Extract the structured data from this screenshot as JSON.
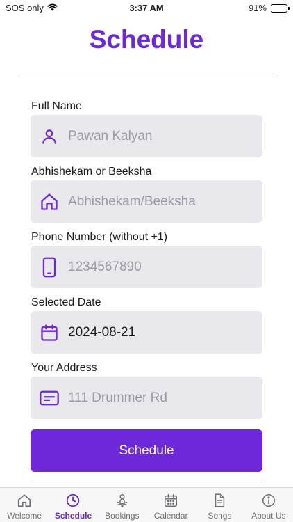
{
  "status_bar": {
    "carrier": "SOS only",
    "time": "3:37 AM",
    "battery": "91%",
    "battery_level": 0.91
  },
  "page": {
    "title": "Schedule"
  },
  "form": {
    "full_name": {
      "label": "Full Name",
      "placeholder": "Pawan Kalyan",
      "value": "",
      "icon": "person-icon"
    },
    "abhishekam": {
      "label": "Abhishekam or Beeksha",
      "placeholder": "Abhishekam/Beeksha",
      "value": "",
      "icon": "home-icon"
    },
    "phone": {
      "label": "Phone Number (without +1)",
      "placeholder": "1234567890",
      "value": "",
      "icon": "phone-icon"
    },
    "date": {
      "label": "Selected Date",
      "value": "2024-08-21",
      "icon": "calendar-icon"
    },
    "address": {
      "label": "Your Address",
      "placeholder": "111 Drummer Rd",
      "value": "",
      "icon": "card-icon"
    },
    "submit_label": "Schedule"
  },
  "tabbar": {
    "active": "Schedule",
    "items": [
      {
        "label": "Welcome",
        "icon": "house-icon"
      },
      {
        "label": "Schedule",
        "icon": "clock-icon"
      },
      {
        "label": "Bookings",
        "icon": "bookings-icon"
      },
      {
        "label": "Calendar",
        "icon": "calendar-grid-icon"
      },
      {
        "label": "Songs",
        "icon": "document-icon"
      },
      {
        "label": "About Us",
        "icon": "info-icon"
      }
    ]
  },
  "colors": {
    "accent": "#6d28d9",
    "field_bg": "#e8e8ed",
    "placeholder": "#9a9aa2"
  }
}
